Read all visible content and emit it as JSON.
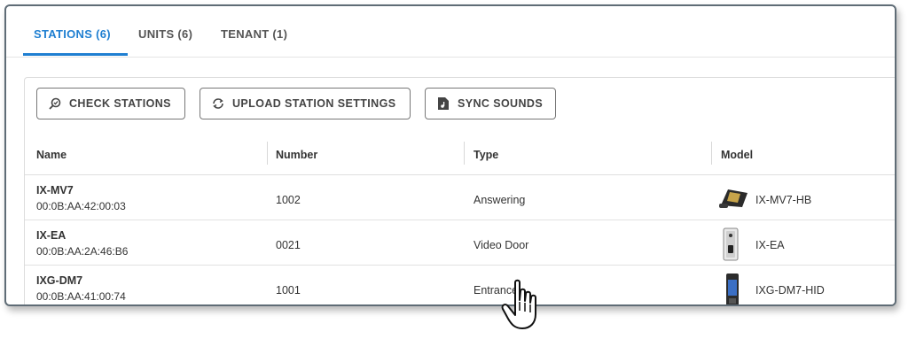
{
  "tabs": [
    {
      "label": "STATIONS (6)",
      "active": true
    },
    {
      "label": "UNITS (6)",
      "active": false
    },
    {
      "label": "TENANT (1)",
      "active": false
    }
  ],
  "toolbar": {
    "check_label": "CHECK STATIONS",
    "upload_label": "UPLOAD STATION SETTINGS",
    "sync_label": "SYNC SOUNDS"
  },
  "table": {
    "headers": {
      "name": "Name",
      "number": "Number",
      "type": "Type",
      "model": "Model"
    },
    "rows": [
      {
        "name": "IX-MV7",
        "mac": "00:0B:AA:42:00:03",
        "number": "1002",
        "type": "Answering",
        "model": "IX-MV7-HB"
      },
      {
        "name": "IX-EA",
        "mac": "00:0B:AA:2A:46:B6",
        "number": "0021",
        "type": "Video Door",
        "model": "IX-EA"
      },
      {
        "name": "IXG-DM7",
        "mac": "00:0B:AA:41:00:74",
        "number": "1001",
        "type": "Entrance",
        "model": "IXG-DM7-HID"
      }
    ]
  },
  "colors": {
    "accent": "#1f7fd1",
    "border": "#5f6c76"
  },
  "icons": [
    "search-check-icon",
    "sync-upload-icon",
    "music-file-icon",
    "hand-pointer-cursor-icon"
  ]
}
